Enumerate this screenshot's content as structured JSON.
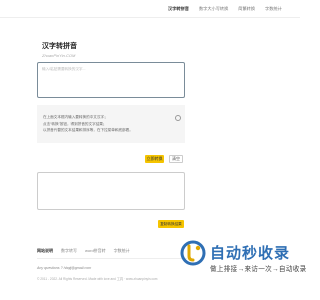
{
  "nav": {
    "items": [
      "汉字转拼音",
      "数字大小写转换",
      "简繁转换",
      "字数统计"
    ],
    "active_index": 0
  },
  "brand": {
    "title": "汉字转拼音",
    "subtitle": "ZhuanPinYin.COM"
  },
  "input": {
    "placeholder": "输入/粘贴需要转换的汉字..."
  },
  "hint": {
    "lines": [
      "在上面文本框内输入要转换的中文汉字；",
      "点击“转换”按钮，得到拼音的文字结果；",
      "以拼音代替的文本结果和排序等，在下拉菜单和底部看。"
    ]
  },
  "buttons": {
    "convert": "立即转换",
    "clear": "清空",
    "copy": "复制转换结果"
  },
  "tabs": {
    "items": [
      "网站说明",
      "数字转写",
      "word拼音转",
      "字数统计"
    ],
    "active_index": 0
  },
  "footer": {
    "email": "Any questions ? hbqij@gmail.com",
    "copyright": "© 2011 - 2022. All Rights Reserved. Made with love and 工具 · www.zhuanpinyin.com"
  },
  "watermark": {
    "main": "自动秒收录",
    "sub": "做上排接→来访一次→自动收录"
  },
  "colors": {
    "accent": "#f5c400",
    "watermark_blue": "#2f6fb4",
    "watermark_gold": "#e0a800"
  }
}
